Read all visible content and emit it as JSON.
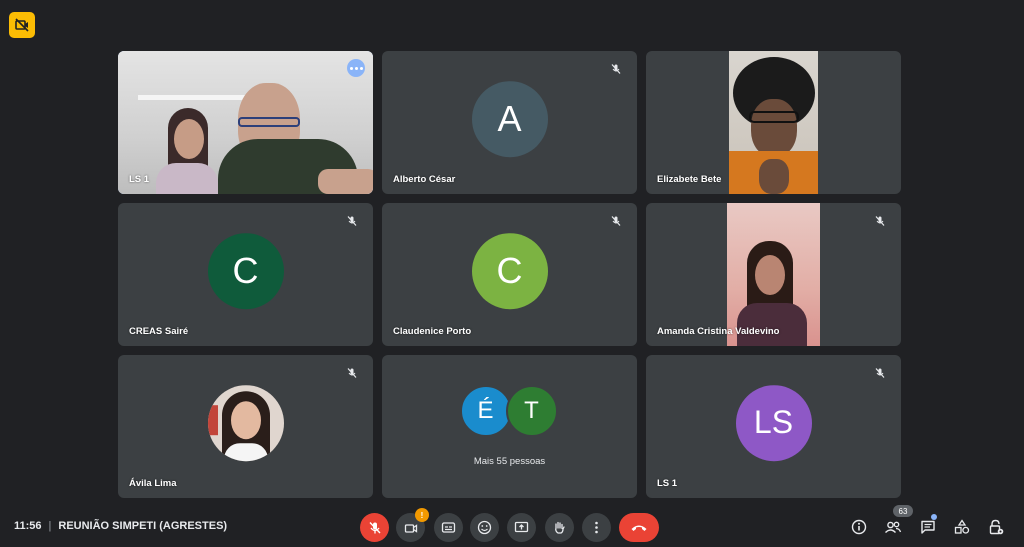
{
  "meeting": {
    "time": "11:56",
    "title": "REUNIÃO SIMPETI (AGRESTES)"
  },
  "tiles": [
    {
      "name": "LS 1",
      "type": "video",
      "active": true
    },
    {
      "name": "Alberto César",
      "type": "avatar",
      "initial": "A",
      "color": "#455a64",
      "muted": true
    },
    {
      "name": "Elizabete Bete",
      "type": "video"
    },
    {
      "name": "CREAS Sairé",
      "type": "avatar",
      "initial": "C",
      "color": "#0f5b3b",
      "muted": true
    },
    {
      "name": "Claudenice Porto",
      "type": "avatar",
      "initial": "C",
      "color": "#7cb342",
      "muted": true
    },
    {
      "name": "Amanda Cristina Valdevino",
      "type": "video",
      "muted": true
    },
    {
      "name": "Ávila Lima",
      "type": "photo",
      "muted": true
    },
    {
      "type": "more",
      "label": "Mais 55 pessoas",
      "avatars": [
        {
          "initial": "É",
          "color": "#1a8ccd"
        },
        {
          "initial": "T",
          "color": "#2e7d32"
        }
      ]
    },
    {
      "name": "LS 1",
      "type": "avatar",
      "initial": "LS",
      "color": "#8e58c6",
      "muted": true
    }
  ],
  "controls": {
    "camera_badge": "!",
    "participants_count": "63"
  },
  "icons": [
    "camera-off-icon",
    "mic-off-icon",
    "more-options-icon",
    "captions-icon",
    "emoji-icon",
    "present-icon",
    "raise-hand-icon",
    "more-vert-icon",
    "end-call-icon",
    "info-icon",
    "people-icon",
    "chat-icon",
    "activities-icon",
    "host-controls-icon"
  ]
}
